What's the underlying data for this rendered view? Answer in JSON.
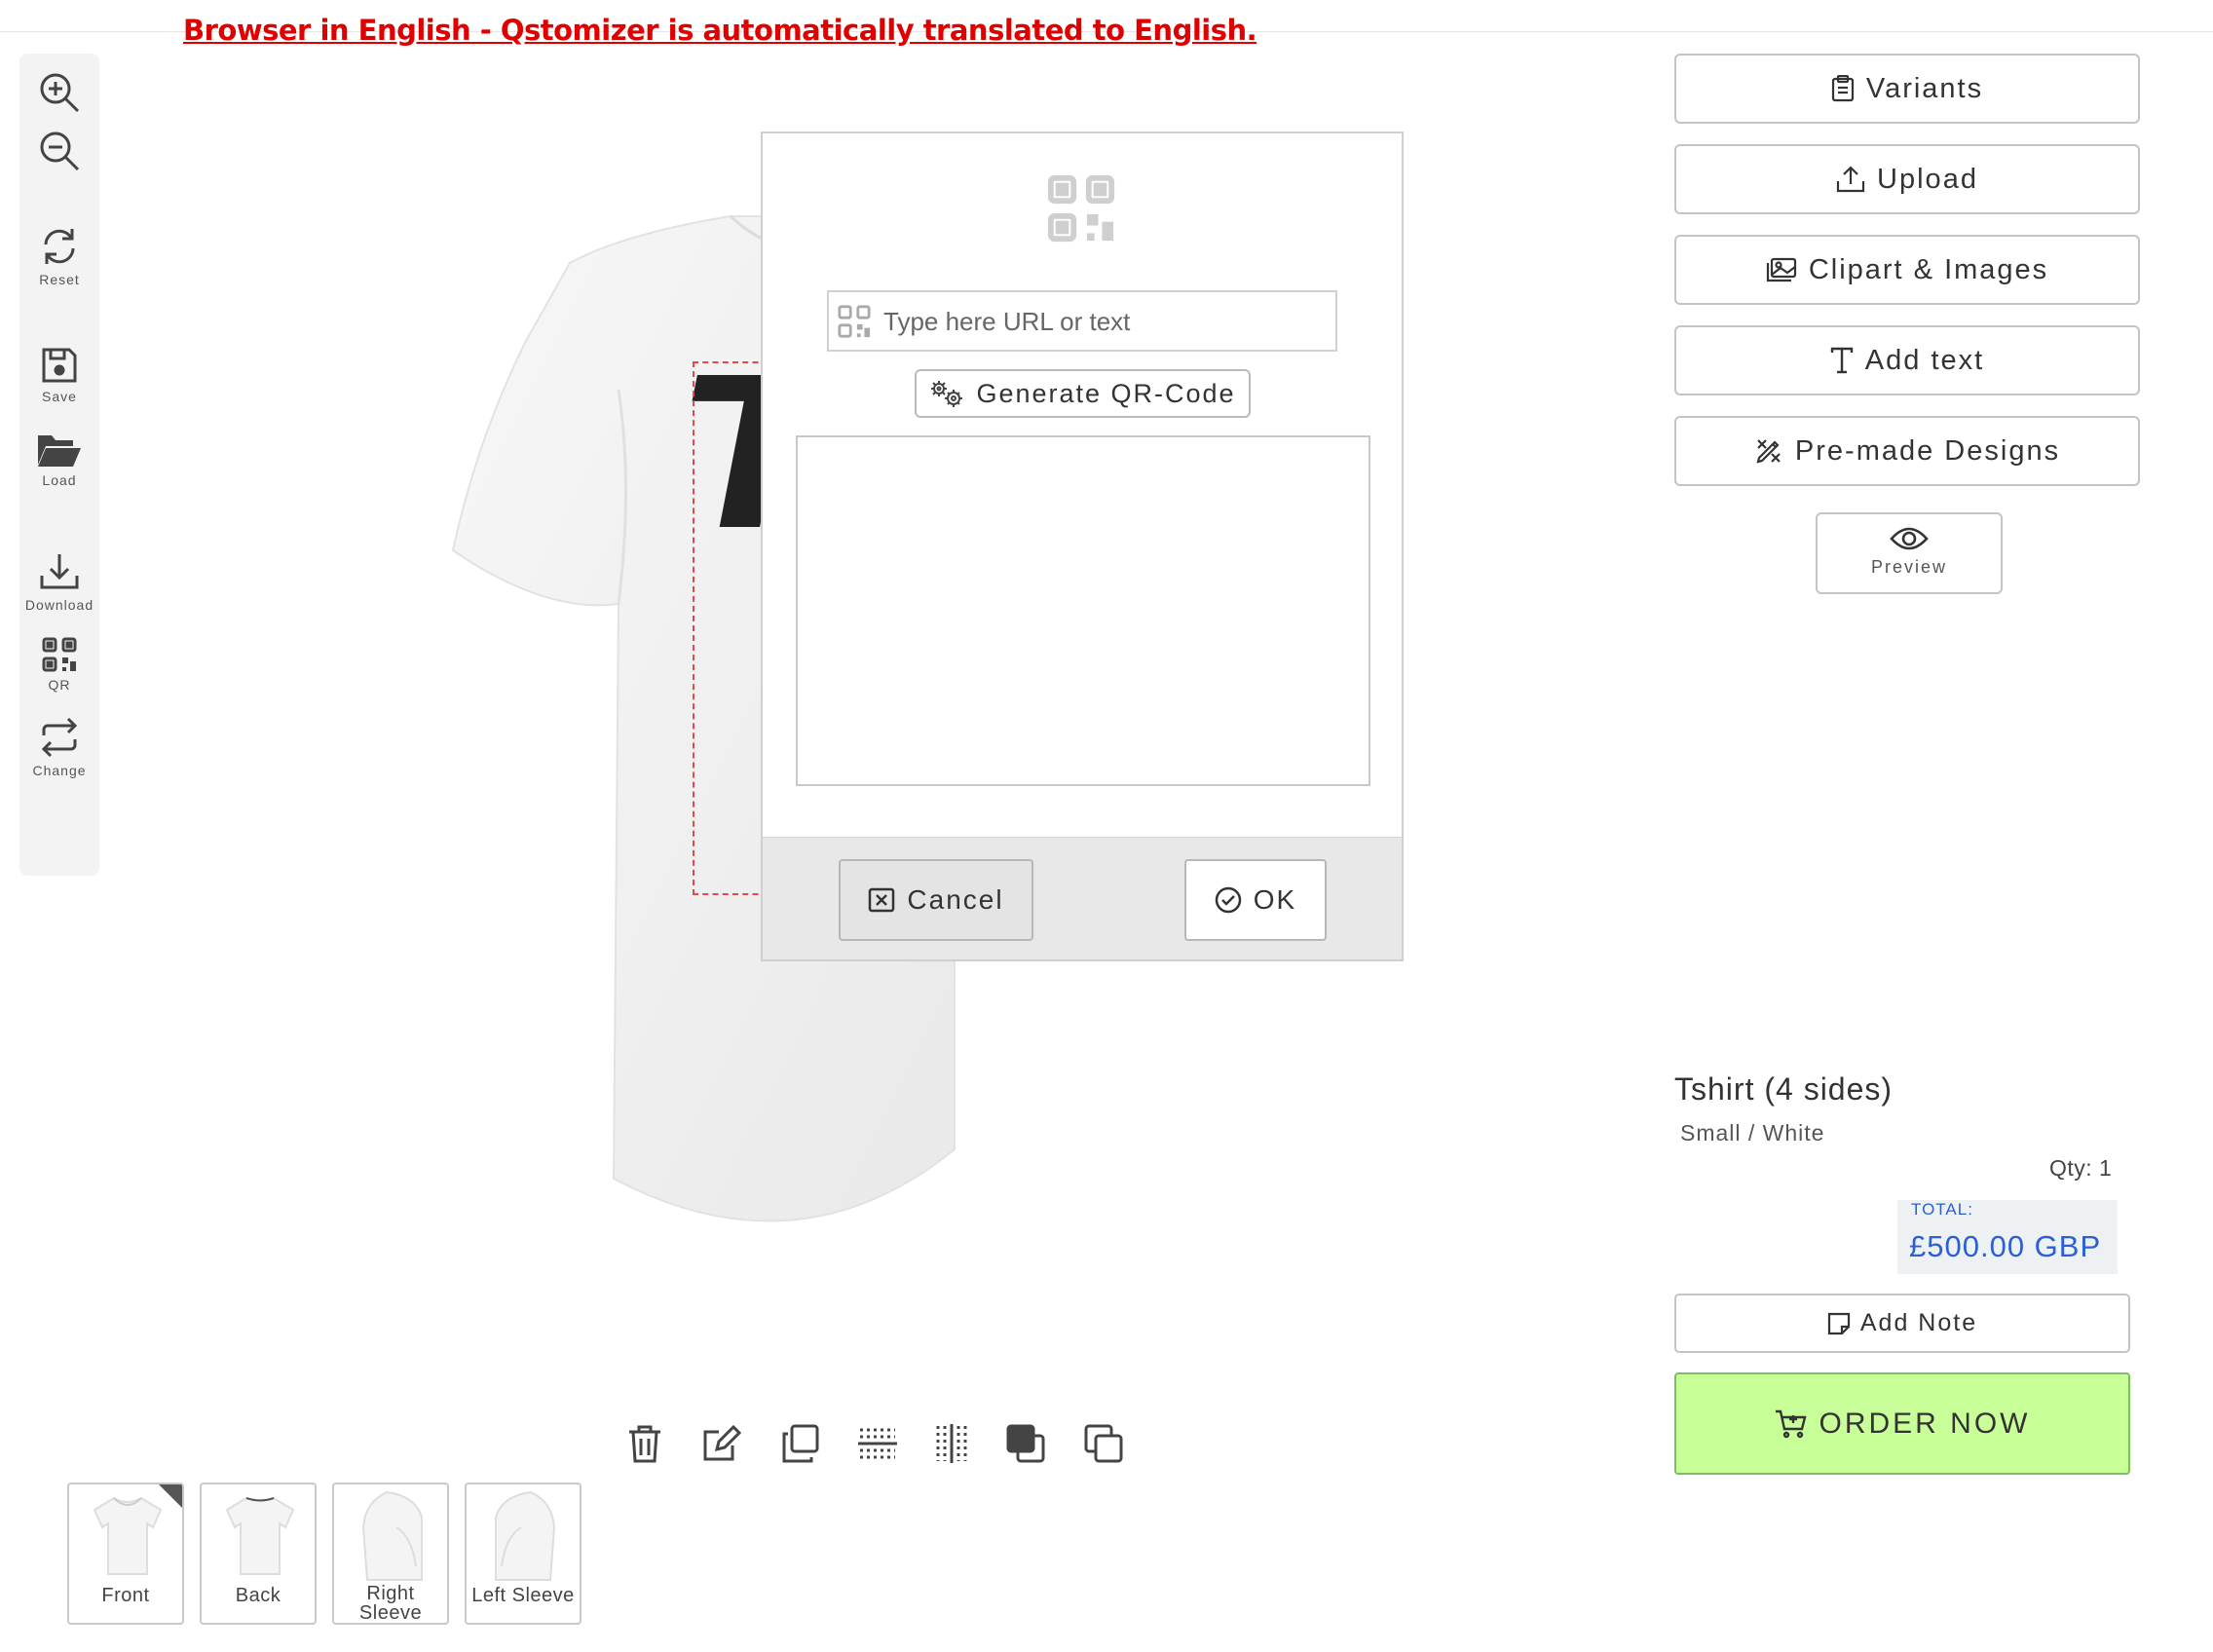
{
  "banner": "Browser in English - Qstomizer is automatically translated to English.",
  "left_toolbar": {
    "reset": "Reset",
    "save": "Save",
    "load": "Load",
    "download": "Download",
    "qr": "QR",
    "change": "Change"
  },
  "qr_modal": {
    "input_placeholder": "Type here URL or text",
    "generate_label": "Generate QR-Code",
    "cancel_label": "Cancel",
    "ok_label": "OK"
  },
  "right_panel": {
    "variants": "Variants",
    "upload": "Upload",
    "clipart": "Clipart & Images",
    "add_text": "Add text",
    "premade": "Pre-made Designs",
    "preview": "Preview"
  },
  "product": {
    "title": "Tshirt (4 sides)",
    "variant": "Small / White",
    "qty": "Qty: 1",
    "total_label": "TOTAL:",
    "total_value": "£500.00 GBP",
    "add_note": "Add Note",
    "order_now": "ORDER NOW"
  },
  "design_text": "T",
  "views": [
    {
      "label": "Front",
      "active": true
    },
    {
      "label": "Back",
      "active": false
    },
    {
      "label": "Right Sleeve",
      "active": false
    },
    {
      "label": "Left Sleeve",
      "active": false
    }
  ],
  "colors": {
    "banner": "#e00000",
    "order_bg": "#c8ff98",
    "total_text": "#2a5fd6",
    "dashed_guide": "#e54848"
  }
}
